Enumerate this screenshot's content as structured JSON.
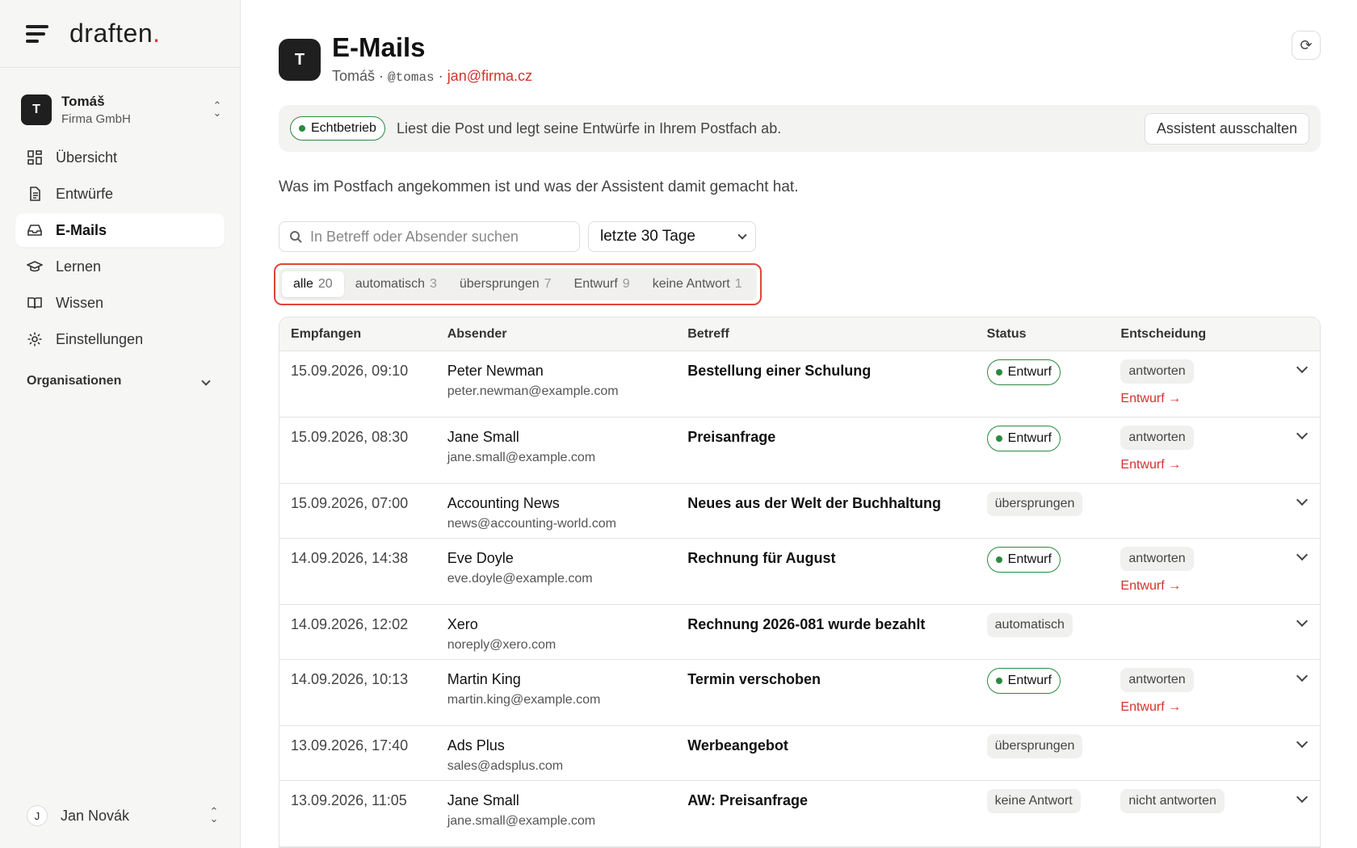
{
  "app": {
    "logo": "draften",
    "logo_dot": "."
  },
  "org": {
    "initial": "T",
    "name": "Tomáš",
    "company": "Firma GmbH"
  },
  "nav": [
    {
      "label": "Übersicht",
      "icon": "grid-icon"
    },
    {
      "label": "Entwürfe",
      "icon": "document-icon"
    },
    {
      "label": "E-Mails",
      "icon": "inbox-icon",
      "active": true
    },
    {
      "label": "Lernen",
      "icon": "graduation-cap-icon"
    },
    {
      "label": "Wissen",
      "icon": "book-icon"
    },
    {
      "label": "Einstellungen",
      "icon": "gear-icon"
    }
  ],
  "sidebar_section": "Organisationen",
  "user": {
    "initial": "J",
    "name": "Jan Novák"
  },
  "header": {
    "initial": "T",
    "title": "E-Mails",
    "name": "Tomáš",
    "handle": "@tomas",
    "email": "jan@firma.cz",
    "separator": "·"
  },
  "banner": {
    "badge": "Echtbetrieb",
    "text": "Liest die Post und legt seine Entwürfe in Ihrem Postfach ab.",
    "button": "Assistent ausschalten"
  },
  "intro": "Was im Postfach angekommen ist und was der Assistent damit gemacht hat.",
  "search": {
    "placeholder": "In Betreff oder Absender suchen"
  },
  "date_filter": {
    "selected": "letzte 30 Tage"
  },
  "tabs": [
    {
      "label": "alle",
      "count": "20"
    },
    {
      "label": "automatisch",
      "count": "3"
    },
    {
      "label": "übersprungen",
      "count": "7"
    },
    {
      "label": "Entwurf",
      "count": "9"
    },
    {
      "label": "keine Antwort",
      "count": "1"
    }
  ],
  "table": {
    "columns": [
      "Empfangen",
      "Absender",
      "Betreff",
      "Status",
      "Entscheidung"
    ],
    "rows": [
      {
        "date": "15.09.2026, 09:10",
        "name": "Peter Newman",
        "email": "peter.newman@example.com",
        "subject": "Bestellung einer Schulung",
        "status": "Entwurf",
        "decision": "antworten",
        "link": "Entwurf →"
      },
      {
        "date": "15.09.2026, 08:30",
        "name": "Jane Small",
        "email": "jane.small@example.com",
        "subject": "Preisanfrage",
        "status": "Entwurf",
        "decision": "antworten",
        "link": "Entwurf →"
      },
      {
        "date": "15.09.2026, 07:00",
        "name": "Accounting News",
        "email": "news@accounting-world.com",
        "subject": "Neues aus der Welt der Buchhaltung",
        "status": "übersprungen",
        "decision": "",
        "link": ""
      },
      {
        "date": "14.09.2026, 14:38",
        "name": "Eve Doyle",
        "email": "eve.doyle@example.com",
        "subject": "Rechnung für August",
        "status": "Entwurf",
        "decision": "antworten",
        "link": "Entwurf →"
      },
      {
        "date": "14.09.2026, 12:02",
        "name": "Xero",
        "email": "noreply@xero.com",
        "subject": "Rechnung 2026-081 wurde bezahlt",
        "status": "automatisch",
        "decision": "",
        "link": ""
      },
      {
        "date": "14.09.2026, 10:13",
        "name": "Martin King",
        "email": "martin.king@example.com",
        "subject": "Termin verschoben",
        "status": "Entwurf",
        "decision": "antworten",
        "link": "Entwurf →"
      },
      {
        "date": "13.09.2026, 17:40",
        "name": "Ads Plus",
        "email": "sales@adsplus.com",
        "subject": "Werbeangebot",
        "status": "übersprungen",
        "decision": "",
        "link": ""
      },
      {
        "date": "13.09.2026, 11:05",
        "name": "Jane Small",
        "email": "jane.small@example.com",
        "subject": "AW: Preisanfrage",
        "status": "keine Antwort",
        "decision": "nicht antworten",
        "link": ""
      }
    ]
  },
  "colors": {
    "accent": "#d1342a",
    "live": "#2a8a3e",
    "highlight": "#e0463b"
  }
}
